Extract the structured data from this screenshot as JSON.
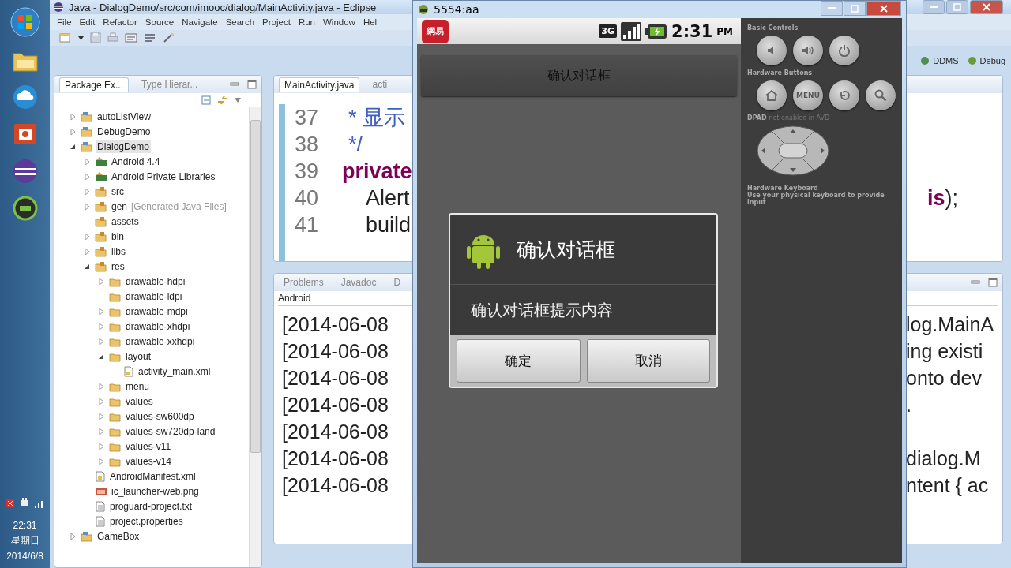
{
  "taskbar": {
    "clock": {
      "time": "22:31",
      "day": "星期日",
      "date": "2014/6/8"
    }
  },
  "eclipse": {
    "title": "Java - DialogDemo/src/com/imooc/dialog/MainActivity.java - Eclipse",
    "menu": [
      "File",
      "Edit",
      "Refactor",
      "Source",
      "Navigate",
      "Search",
      "Project",
      "Run",
      "Window",
      "Hel"
    ],
    "perspectives": [
      {
        "label": "DDMS",
        "selected": false
      },
      {
        "label": "Debug",
        "selected": false
      }
    ],
    "package_explorer": {
      "tabs": [
        {
          "label": "Package Ex...",
          "selected": true
        },
        {
          "label": "Type Hierar...",
          "selected": false
        }
      ],
      "tree": [
        {
          "label": "autoListView",
          "kind": "project",
          "expanded": false,
          "selected": false
        },
        {
          "label": "DebugDemo",
          "kind": "project",
          "expanded": false,
          "selected": false
        },
        {
          "label": "DialogDemo",
          "kind": "project",
          "expanded": true,
          "selected": true,
          "children": [
            {
              "label": "Android 4.4",
              "kind": "library",
              "expanded": false,
              "selected": false
            },
            {
              "label": "Android Private Libraries",
              "kind": "library",
              "expanded": false,
              "selected": false
            },
            {
              "label": "src",
              "kind": "source",
              "expanded": false,
              "selected": false
            },
            {
              "label": "gen",
              "note": "[Generated Java Files]",
              "kind": "source",
              "expanded": false,
              "selected": false
            },
            {
              "label": "assets",
              "kind": "source",
              "selected": false
            },
            {
              "label": "bin",
              "kind": "source",
              "expanded": false,
              "selected": false
            },
            {
              "label": "libs",
              "kind": "source",
              "expanded": false,
              "selected": false
            },
            {
              "label": "res",
              "kind": "source",
              "expanded": true,
              "selected": false,
              "children": [
                {
                  "label": "drawable-hdpi",
                  "kind": "folder",
                  "expanded": false,
                  "selected": false
                },
                {
                  "label": "drawable-ldpi",
                  "kind": "folder",
                  "selected": false
                },
                {
                  "label": "drawable-mdpi",
                  "kind": "folder",
                  "expanded": false,
                  "selected": false
                },
                {
                  "label": "drawable-xhdpi",
                  "kind": "folder",
                  "expanded": false,
                  "selected": false
                },
                {
                  "label": "drawable-xxhdpi",
                  "kind": "folder",
                  "expanded": false,
                  "selected": false
                },
                {
                  "label": "layout",
                  "kind": "folder",
                  "expanded": true,
                  "selected": false,
                  "children": [
                    {
                      "label": "activity_main.xml",
                      "kind": "xml",
                      "selected": false
                    }
                  ]
                },
                {
                  "label": "menu",
                  "kind": "folder",
                  "expanded": false,
                  "selected": false
                },
                {
                  "label": "values",
                  "kind": "folder",
                  "expanded": false,
                  "selected": false
                },
                {
                  "label": "values-sw600dp",
                  "kind": "folder",
                  "expanded": false,
                  "selected": false
                },
                {
                  "label": "values-sw720dp-land",
                  "kind": "folder",
                  "expanded": false,
                  "selected": false
                },
                {
                  "label": "values-v11",
                  "kind": "folder",
                  "expanded": false,
                  "selected": false
                },
                {
                  "label": "values-v14",
                  "kind": "folder",
                  "expanded": false,
                  "selected": false
                }
              ]
            },
            {
              "label": "AndroidManifest.xml",
              "kind": "xml",
              "selected": false
            },
            {
              "label": "ic_launcher-web.png",
              "kind": "image",
              "selected": false
            },
            {
              "label": "proguard-project.txt",
              "kind": "text",
              "selected": false
            },
            {
              "label": "project.properties",
              "kind": "text",
              "selected": false
            }
          ]
        },
        {
          "label": "GameBox",
          "kind": "project",
          "expanded": false,
          "selected": false
        }
      ]
    },
    "editor": {
      "tabs": [
        {
          "label": "MainActivity.java",
          "selected": true
        },
        {
          "label": "acti",
          "selected": false
        }
      ],
      "lines": [
        {
          "number": "37",
          "kind": "comment",
          "code": "* 显示"
        },
        {
          "number": "38",
          "kind": "comment",
          "code": "*/"
        },
        {
          "number": "39",
          "kind": "keyword",
          "code": "private"
        },
        {
          "number": "40",
          "kind": "plain",
          "code": "Alert",
          "end": "**is**);"
        },
        {
          "number": "41",
          "kind": "plain",
          "code": "build"
        }
      ]
    },
    "console": {
      "tabs": [
        {
          "label": "Problems",
          "selected": false
        },
        {
          "label": "Javadoc",
          "selected": false
        },
        {
          "label": "D",
          "selected": false
        }
      ],
      "header": "Android",
      "lines": [
        {
          "start": "[2014-06-08",
          "end": "log.MainA"
        },
        {
          "start": "[2014-06-08",
          "end": "ing existi"
        },
        {
          "start": "[2014-06-08",
          "end": "onto dev"
        },
        {
          "start": "[2014-06-08",
          "end": "."
        },
        {
          "start": "[2014-06-08"
        },
        {
          "start": "[2014-06-08",
          "end": "dialog.M"
        },
        {
          "start": "[2014-06-08",
          "end": "ntent { ac"
        }
      ]
    }
  },
  "emulator": {
    "title": "5554:aa",
    "status": {
      "notification": "網易",
      "network": "3G",
      "time": "2:31",
      "ampm": "PM"
    },
    "action_bar_title": "确认对话框",
    "dialog": {
      "title": "确认对话框",
      "message": "确认对话框提示内容",
      "buttons": [
        "确定",
        "取消"
      ]
    },
    "controls": {
      "basic_label": "Basic Controls",
      "hardware_label": "Hardware Buttons",
      "menu_key": "MENU",
      "dpad_label": "DPAD",
      "dpad_note": "not enabled in AVD",
      "keyboard_title": "Hardware Keyboard",
      "keyboard_note": "Use your physical keyboard to provide input"
    }
  }
}
